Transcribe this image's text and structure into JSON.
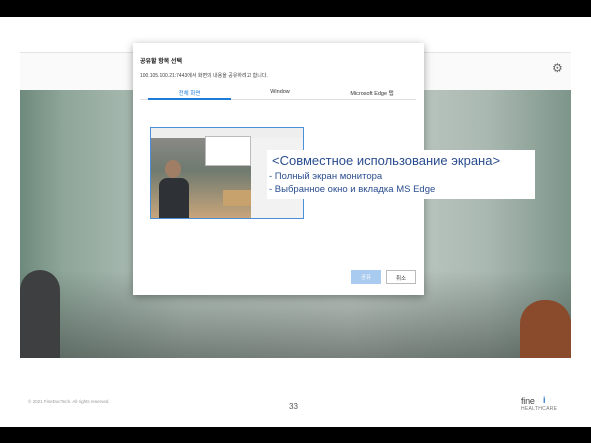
{
  "dialog": {
    "title": "공유할 항목 선택",
    "subtitle": "100.105.100.21:7443에서 화면의 내용을 공유하려고 합니다.",
    "tabs": [
      {
        "label": "전체 화면",
        "active": true
      },
      {
        "label": "Window",
        "active": false
      },
      {
        "label": "Microsoft Edge 탭",
        "active": false
      }
    ],
    "ok_label": "공유",
    "cancel_label": "취소"
  },
  "callout": {
    "title": "<Совместное использование экрана>",
    "lines": [
      "- Полный экран монитора",
      "- Выбранное окно и вкладка MS Edge"
    ]
  },
  "footer": {
    "copyright": "© 2021 FineDocTech. All rights reserved.",
    "page_number": "33",
    "logo_main": "fine",
    "logo_sub": "HEALTHCARE"
  },
  "icons": {
    "settings": "gear-icon"
  },
  "colors": {
    "accent": "#1e7bd8",
    "callout_text": "#2a4d8f"
  }
}
